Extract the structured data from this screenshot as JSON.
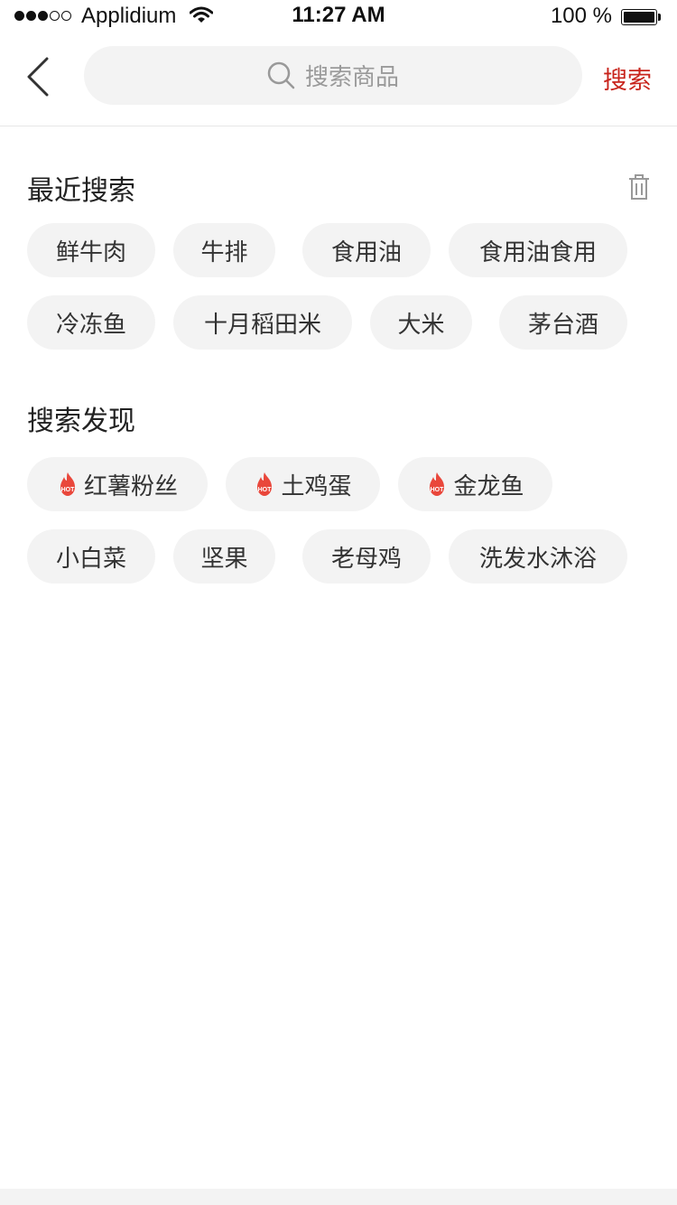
{
  "status_bar": {
    "carrier": "Applidium",
    "time": "11:27 AM",
    "battery": "100 %"
  },
  "header": {
    "search_placeholder": "搜索商品",
    "search_button": "搜索"
  },
  "recent": {
    "title": "最近搜索",
    "items": [
      "鲜牛肉",
      "牛排",
      "食用油",
      "食用油食用",
      "冷冻鱼",
      "十月稻田米",
      "大米",
      "茅台酒"
    ]
  },
  "discover": {
    "title": "搜索发现",
    "items": [
      "红薯粉丝",
      "土鸡蛋",
      "金龙鱼",
      "小白菜",
      "坚果",
      "老母鸡",
      "洗发水沐浴"
    ],
    "hot_label": "HOT"
  },
  "colors": {
    "accent": "#c8241c",
    "chip_bg": "#f3f3f3",
    "hot_flame": "#e9473b"
  },
  "icons": [
    "back-chevron-icon",
    "search-icon",
    "trash-icon",
    "hot-flame-icon",
    "wifi-icon",
    "battery-icon"
  ]
}
